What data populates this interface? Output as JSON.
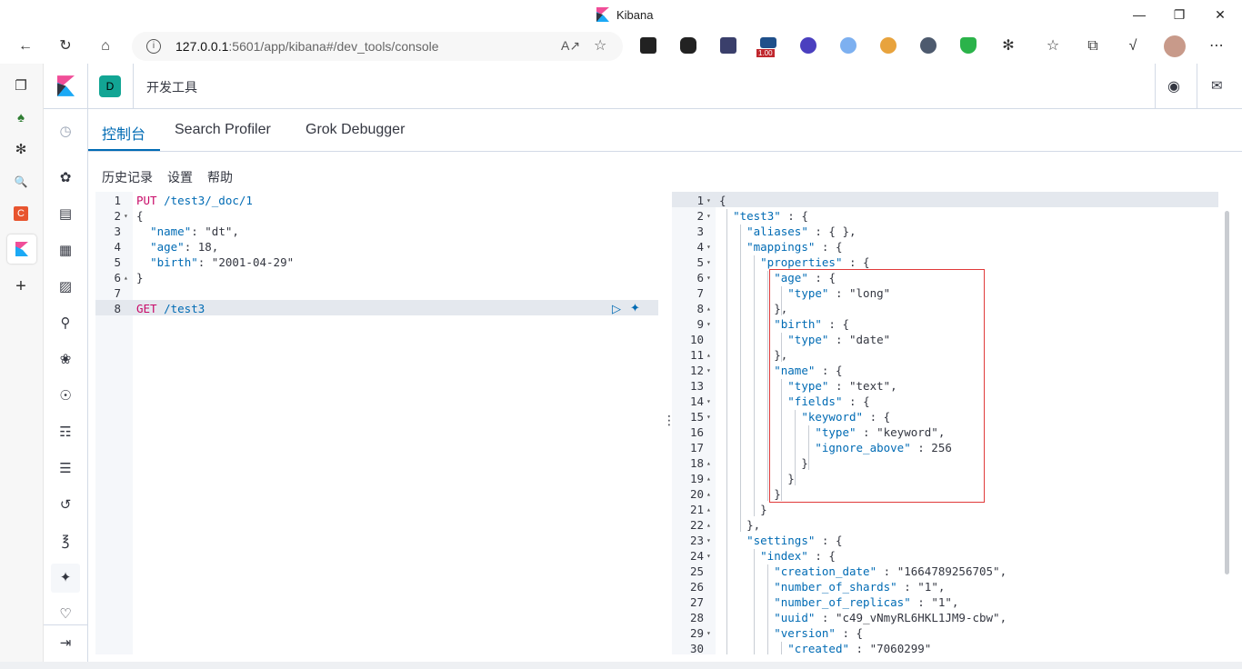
{
  "browser": {
    "tab_title": "Kibana",
    "url_host": "127.0.0.1",
    "url_path": ":5601/app/kibana#/dev_tools/console",
    "ext_badge": "1.00"
  },
  "kibana": {
    "space_initial": "D",
    "breadcrumb": "开发工具",
    "tabs": [
      "控制台",
      "Search Profiler",
      "Grok Debugger"
    ],
    "subnav": [
      "历史记录",
      "设置",
      "帮助"
    ]
  },
  "request": {
    "lines": [
      {
        "n": "1",
        "text": "PUT /test3/_doc/1"
      },
      {
        "n": "2",
        "text": "{"
      },
      {
        "n": "3",
        "text": "  \"name\": \"dt\","
      },
      {
        "n": "4",
        "text": "  \"age\": 18,"
      },
      {
        "n": "5",
        "text": "  \"birth\": \"2001-04-29\""
      },
      {
        "n": "6",
        "text": "}"
      },
      {
        "n": "7",
        "text": ""
      },
      {
        "n": "8",
        "text": "GET /test3"
      }
    ]
  },
  "response": {
    "lines": [
      {
        "n": "1",
        "text": "{"
      },
      {
        "n": "2",
        "text": "  \"test3\" : {"
      },
      {
        "n": "3",
        "text": "    \"aliases\" : { },"
      },
      {
        "n": "4",
        "text": "    \"mappings\" : {"
      },
      {
        "n": "5",
        "text": "      \"properties\" : {"
      },
      {
        "n": "6",
        "text": "        \"age\" : {"
      },
      {
        "n": "7",
        "text": "          \"type\" : \"long\""
      },
      {
        "n": "8",
        "text": "        },"
      },
      {
        "n": "9",
        "text": "        \"birth\" : {"
      },
      {
        "n": "10",
        "text": "          \"type\" : \"date\""
      },
      {
        "n": "11",
        "text": "        },"
      },
      {
        "n": "12",
        "text": "        \"name\" : {"
      },
      {
        "n": "13",
        "text": "          \"type\" : \"text\","
      },
      {
        "n": "14",
        "text": "          \"fields\" : {"
      },
      {
        "n": "15",
        "text": "            \"keyword\" : {"
      },
      {
        "n": "16",
        "text": "              \"type\" : \"keyword\","
      },
      {
        "n": "17",
        "text": "              \"ignore_above\" : 256"
      },
      {
        "n": "18",
        "text": "            }"
      },
      {
        "n": "19",
        "text": "          }"
      },
      {
        "n": "20",
        "text": "        }"
      },
      {
        "n": "21",
        "text": "      }"
      },
      {
        "n": "22",
        "text": "    },"
      },
      {
        "n": "23",
        "text": "    \"settings\" : {"
      },
      {
        "n": "24",
        "text": "      \"index\" : {"
      },
      {
        "n": "25",
        "text": "        \"creation_date\" : \"1664789256705\","
      },
      {
        "n": "26",
        "text": "        \"number_of_shards\" : \"1\","
      },
      {
        "n": "27",
        "text": "        \"number_of_replicas\" : \"1\","
      },
      {
        "n": "28",
        "text": "        \"uuid\" : \"c49_vNmyRL6HKL1JM9-cbw\","
      },
      {
        "n": "29",
        "text": "        \"version\" : {"
      },
      {
        "n": "30",
        "text": "          \"created\" : \"7060299\""
      }
    ]
  },
  "colors": {
    "accent": "#006bb4",
    "method": "#c80a68",
    "string": "#017d73",
    "highlight_border": "#e03a3a"
  }
}
